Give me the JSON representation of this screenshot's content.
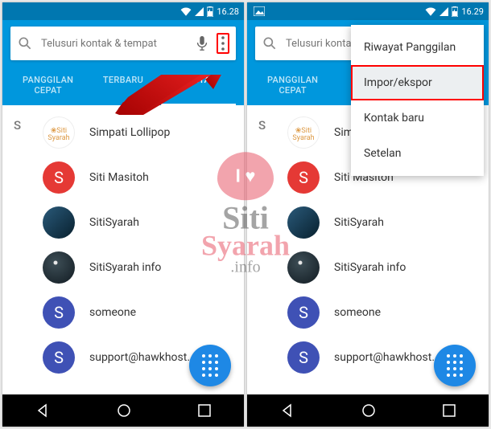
{
  "status": {
    "time1": "16.28",
    "time2": "16.29"
  },
  "search": {
    "placeholder": "Telusuri kontak & tempat"
  },
  "tabs": {
    "a": "PANGGILAN CEPAT",
    "b": "TERBARU",
    "c": "KONTAK"
  },
  "section_letter": "S",
  "contacts": [
    {
      "name": "Simpati Lollipop",
      "avatar": "logo"
    },
    {
      "name": "Siti Masitoh",
      "avatar": "letter-red",
      "letter": "S"
    },
    {
      "name": "SitiSyarah",
      "avatar": "img1"
    },
    {
      "name": "SitiSyarah info",
      "avatar": "img2"
    },
    {
      "name": "someone",
      "avatar": "letter-blue",
      "letter": "S"
    },
    {
      "name": "support@hawkhost.…",
      "avatar": "letter-blue",
      "letter": "S"
    }
  ],
  "menu": {
    "items": [
      "Riwayat Panggilan",
      "Impor/ekspor",
      "Kontak baru",
      "Setelan"
    ],
    "selected_index": 1
  },
  "watermark": {
    "love": "I ♥",
    "line1": "Siti",
    "line2": "Syarah",
    "line3": ".info"
  }
}
